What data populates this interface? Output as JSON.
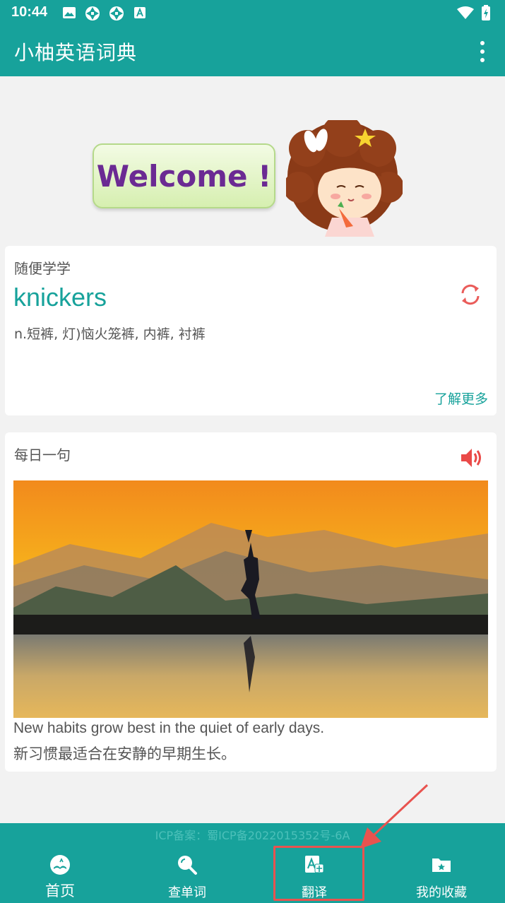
{
  "status_bar": {
    "time": "10:44"
  },
  "app_bar": {
    "title": "小柚英语词典"
  },
  "welcome": {
    "text": "Welcome !"
  },
  "random_learn": {
    "label": "随便学学",
    "word": "knickers",
    "meaning": "n.短裤, 灯)恼火笼裤, 内裤, 衬裤",
    "more_link": "了解更多"
  },
  "daily_sentence": {
    "label": "每日一句",
    "english": "New habits grow best in the quiet of early days.",
    "chinese": "新习惯最适合在安静的早期生长。"
  },
  "footer": {
    "icp": "ICP备案：蜀ICP备2022015352号-6A"
  },
  "bottom_nav": [
    {
      "label": "首页",
      "icon": "home-book-icon"
    },
    {
      "label": "查单词",
      "icon": "search-icon"
    },
    {
      "label": "翻译",
      "icon": "translate-icon"
    },
    {
      "label": "我的收藏",
      "icon": "favorites-folder-icon"
    }
  ],
  "colors": {
    "primary": "#17a29b",
    "accent": "#e8534f",
    "welcome_text": "#6b2a93"
  }
}
